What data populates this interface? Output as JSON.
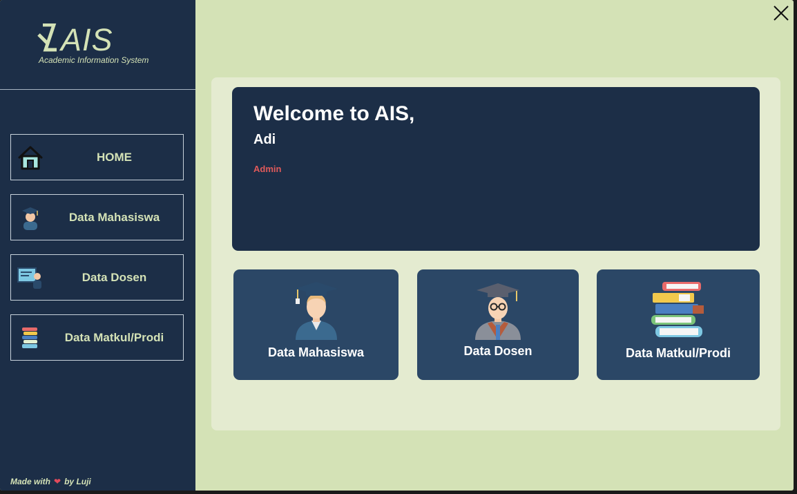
{
  "logo": {
    "title": "AIS",
    "subtitle": "Academic Information System"
  },
  "sidebar": {
    "items": [
      {
        "label": "HOME",
        "icon": "home-icon"
      },
      {
        "label": "Data Mahasiswa",
        "icon": "student-icon"
      },
      {
        "label": "Data Dosen",
        "icon": "teacher-board-icon"
      },
      {
        "label": "Data Matkul/Prodi",
        "icon": "books-icon"
      }
    ],
    "footer": {
      "made_with": "Made with",
      "by": "by",
      "author": "Luji"
    }
  },
  "welcome": {
    "title": "Welcome to AIS,",
    "name": "Adi",
    "role": "Admin"
  },
  "cards": [
    {
      "label": "Data Mahasiswa",
      "icon": "graduate-student-icon"
    },
    {
      "label": "Data Dosen",
      "icon": "professor-icon"
    },
    {
      "label": "Data Matkul/Prodi",
      "icon": "book-stack-icon"
    }
  ],
  "colors": {
    "background": "#d4e2b6",
    "sidebar": "#1c2e47",
    "card": "#2b4766",
    "accent_text": "#d4e2b6",
    "role": "#e05a5a"
  }
}
